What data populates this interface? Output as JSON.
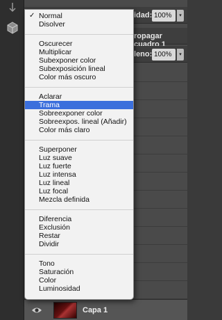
{
  "panel": {
    "opacity_label": "idad:",
    "opacity_value": "100%",
    "propagate_label": "ropagar cuadro 1",
    "fill_label": "leno:",
    "fill_value": "100%",
    "dropdown_arrow": "▾"
  },
  "layer": {
    "name": "Capa 1"
  },
  "blend_menu": {
    "checked_mark": "✓",
    "groups": [
      [
        "Normal",
        "Disolver"
      ],
      [
        "Oscurecer",
        "Multiplicar",
        "Subexponer color",
        "Subexposición lineal",
        "Color más oscuro"
      ],
      [
        "Aclarar",
        "Trama",
        "Sobreexponer color",
        "Sobreexpos. lineal (Añadir)",
        "Color más claro"
      ],
      [
        "Superponer",
        "Luz suave",
        "Luz fuerte",
        "Luz intensa",
        "Luz lineal",
        "Luz focal",
        "Mezcla definida"
      ],
      [
        "Diferencia",
        "Exclusión",
        "Restar",
        "Dividir"
      ],
      [
        "Tono",
        "Saturación",
        "Color",
        "Luminosidad"
      ]
    ],
    "checked_item": "Normal",
    "highlighted_item": "Trama",
    "highlight_color": "#3b6fdc"
  }
}
